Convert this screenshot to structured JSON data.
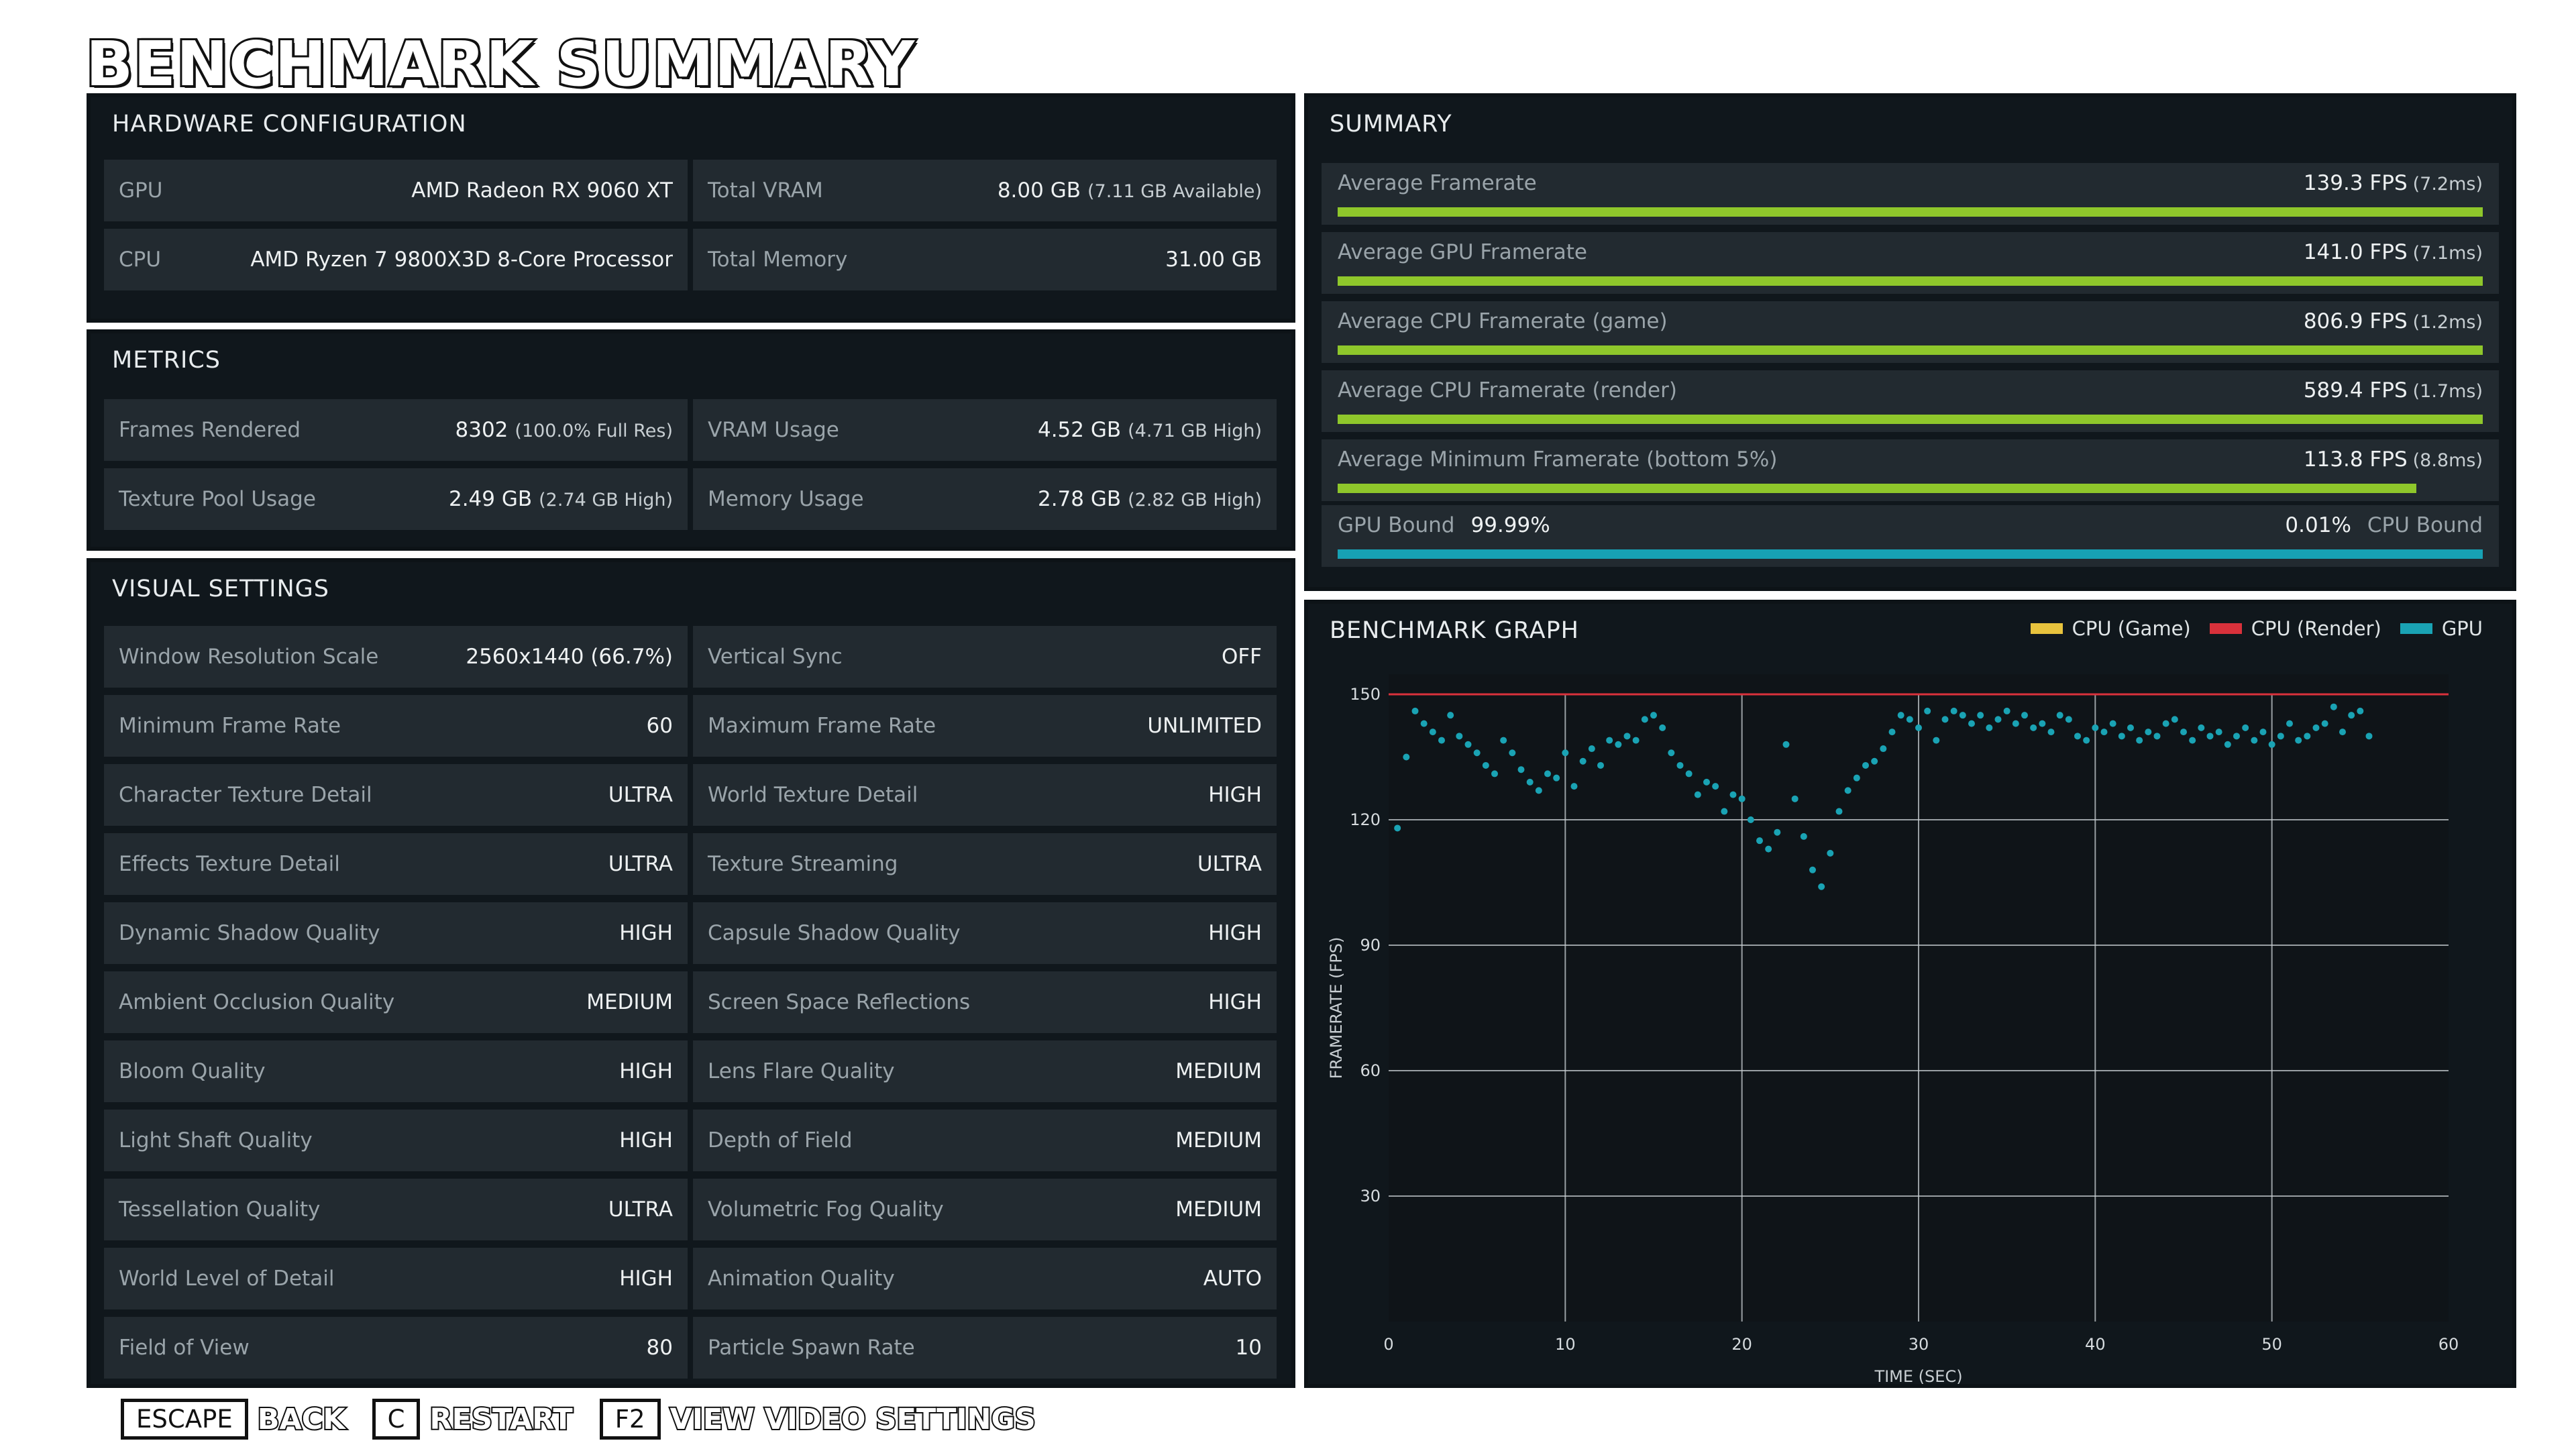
{
  "title": "BENCHMARK SUMMARY",
  "hardware": {
    "header": "HARDWARE CONFIGURATION",
    "rows": [
      [
        {
          "label": "GPU",
          "value": "AMD Radeon RX 9060 XT",
          "sub": ""
        },
        {
          "label": "Total VRAM",
          "value": "8.00 GB",
          "sub": "(7.11 GB Available)"
        }
      ],
      [
        {
          "label": "CPU",
          "value": "AMD Ryzen 7 9800X3D 8-Core Processor",
          "sub": ""
        },
        {
          "label": "Total Memory",
          "value": "31.00 GB",
          "sub": ""
        }
      ]
    ]
  },
  "metrics": {
    "header": "METRICS",
    "rows": [
      [
        {
          "label": "Frames Rendered",
          "value": "8302",
          "sub": "(100.0% Full Res)"
        },
        {
          "label": "VRAM Usage",
          "value": "4.52 GB",
          "sub": "(4.71 GB High)"
        }
      ],
      [
        {
          "label": "Texture Pool Usage",
          "value": "2.49 GB",
          "sub": "(2.74 GB High)"
        },
        {
          "label": "Memory Usage",
          "value": "2.78 GB",
          "sub": "(2.82 GB High)"
        }
      ]
    ]
  },
  "visual": {
    "header": "VISUAL SETTINGS",
    "rows": [
      [
        {
          "label": "Window Resolution Scale",
          "value": "2560x1440 (66.7%)"
        },
        {
          "label": "Vertical Sync",
          "value": "OFF"
        }
      ],
      [
        {
          "label": "Minimum Frame Rate",
          "value": "60"
        },
        {
          "label": "Maximum Frame Rate",
          "value": "UNLIMITED"
        }
      ],
      [
        {
          "label": "Character Texture Detail",
          "value": "ULTRA"
        },
        {
          "label": "World Texture Detail",
          "value": "HIGH"
        }
      ],
      [
        {
          "label": "Effects Texture Detail",
          "value": "ULTRA"
        },
        {
          "label": "Texture Streaming",
          "value": "ULTRA"
        }
      ],
      [
        {
          "label": "Dynamic Shadow Quality",
          "value": "HIGH"
        },
        {
          "label": "Capsule Shadow Quality",
          "value": "HIGH"
        }
      ],
      [
        {
          "label": "Ambient Occlusion Quality",
          "value": "MEDIUM"
        },
        {
          "label": "Screen Space Reflections",
          "value": "HIGH"
        }
      ],
      [
        {
          "label": "Bloom Quality",
          "value": "HIGH"
        },
        {
          "label": "Lens Flare Quality",
          "value": "MEDIUM"
        }
      ],
      [
        {
          "label": "Light Shaft Quality",
          "value": "HIGH"
        },
        {
          "label": "Depth of Field",
          "value": "MEDIUM"
        }
      ],
      [
        {
          "label": "Tessellation Quality",
          "value": "ULTRA"
        },
        {
          "label": "Volumetric Fog Quality",
          "value": "MEDIUM"
        }
      ],
      [
        {
          "label": "World Level of Detail",
          "value": "HIGH"
        },
        {
          "label": "Animation Quality",
          "value": "AUTO"
        }
      ],
      [
        {
          "label": "Field of View",
          "value": "80"
        },
        {
          "label": "Particle Spawn Rate",
          "value": "10"
        }
      ]
    ]
  },
  "summary": {
    "header": "SUMMARY",
    "rows": [
      {
        "label": "Average Framerate",
        "value": "139.3 FPS",
        "sub": "(7.2ms)",
        "fill": 1.0
      },
      {
        "label": "Average GPU Framerate",
        "value": "141.0 FPS",
        "sub": "(7.1ms)",
        "fill": 1.0
      },
      {
        "label": "Average CPU Framerate (game)",
        "value": "806.9 FPS",
        "sub": "(1.2ms)",
        "fill": 1.0
      },
      {
        "label": "Average CPU Framerate (render)",
        "value": "589.4 FPS",
        "sub": "(1.7ms)",
        "fill": 1.0
      },
      {
        "label": "Average Minimum Framerate (bottom 5%)",
        "value": "113.8 FPS",
        "sub": "(8.8ms)",
        "fill": 0.942
      }
    ],
    "bound": {
      "gpu_label": "GPU Bound",
      "gpu_value": "99.99%",
      "cpu_label": "CPU Bound",
      "cpu_value": "0.01%",
      "fill": 1.0
    }
  },
  "graph": {
    "header": "BENCHMARK GRAPH",
    "legend": [
      {
        "name": "CPU (Game)",
        "color": "#e8c33d"
      },
      {
        "name": "CPU (Render)",
        "color": "#d9313b"
      },
      {
        "name": "GPU",
        "color": "#1aa3b4"
      }
    ]
  },
  "chart_data": {
    "type": "scatter",
    "xlabel": "TIME (SEC)",
    "ylabel": "FRAMERATE (FPS)",
    "xlim": [
      0,
      60
    ],
    "ylim": [
      0,
      150
    ],
    "xticks": [
      0,
      10,
      20,
      30,
      40,
      50,
      60
    ],
    "yticks": [
      30,
      60,
      90,
      120,
      150
    ],
    "grid": true,
    "legend_position": "top-right",
    "series": [
      {
        "name": "CPU (Game)",
        "color": "#e8c33d",
        "x": [
          0,
          56
        ],
        "y": [
          150,
          150
        ]
      },
      {
        "name": "CPU (Render)",
        "color": "#d9313b",
        "x": [
          0,
          60
        ],
        "y": [
          150,
          150
        ]
      },
      {
        "name": "GPU",
        "color": "#1aa3b4",
        "x": [
          0.5,
          1,
          1.5,
          2,
          2.5,
          3,
          3.5,
          4,
          4.5,
          5,
          5.5,
          6,
          6.5,
          7,
          7.5,
          8,
          8.5,
          9,
          9.5,
          10,
          10.5,
          11,
          11.5,
          12,
          12.5,
          13,
          13.5,
          14,
          14.5,
          15,
          15.5,
          16,
          16.5,
          17,
          17.5,
          18,
          18.5,
          19,
          19.5,
          20,
          20.5,
          21,
          21.5,
          22,
          22.5,
          23,
          23.5,
          24,
          24.5,
          25,
          25.5,
          26,
          26.5,
          27,
          27.5,
          28,
          28.5,
          29,
          29.5,
          30,
          30.5,
          31,
          31.5,
          32,
          32.5,
          33,
          33.5,
          34,
          34.5,
          35,
          35.5,
          36,
          36.5,
          37,
          37.5,
          38,
          38.5,
          39,
          39.5,
          40,
          40.5,
          41,
          41.5,
          42,
          42.5,
          43,
          43.5,
          44,
          44.5,
          45,
          45.5,
          46,
          46.5,
          47,
          47.5,
          48,
          48.5,
          49,
          49.5,
          50,
          50.5,
          51,
          51.5,
          52,
          52.5,
          53,
          53.5,
          54,
          54.5,
          55,
          55.5
        ],
        "y": [
          118,
          135,
          146,
          143,
          141,
          139,
          145,
          140,
          138,
          136,
          133,
          131,
          139,
          136,
          132,
          129,
          127,
          131,
          130,
          136,
          128,
          134,
          137,
          133,
          139,
          138,
          140,
          139,
          144,
          145,
          142,
          136,
          133,
          131,
          126,
          129,
          128,
          122,
          126,
          125,
          120,
          115,
          113,
          117,
          138,
          125,
          116,
          108,
          104,
          112,
          122,
          127,
          130,
          133,
          134,
          137,
          141,
          145,
          144,
          142,
          146,
          139,
          144,
          146,
          145,
          143,
          145,
          142,
          144,
          146,
          143,
          145,
          142,
          143,
          141,
          145,
          144,
          140,
          139,
          142,
          141,
          143,
          140,
          142,
          139,
          141,
          140,
          143,
          144,
          141,
          139,
          142,
          140,
          141,
          138,
          140,
          142,
          139,
          141,
          138,
          140,
          143,
          139,
          140,
          142,
          143,
          147,
          141,
          145,
          146,
          140
        ]
      }
    ]
  },
  "footer": [
    {
      "key": "ESCAPE",
      "label": "BACK"
    },
    {
      "key": "C",
      "label": "RESTART"
    },
    {
      "key": "F2",
      "label": "VIEW VIDEO SETTINGS"
    }
  ]
}
